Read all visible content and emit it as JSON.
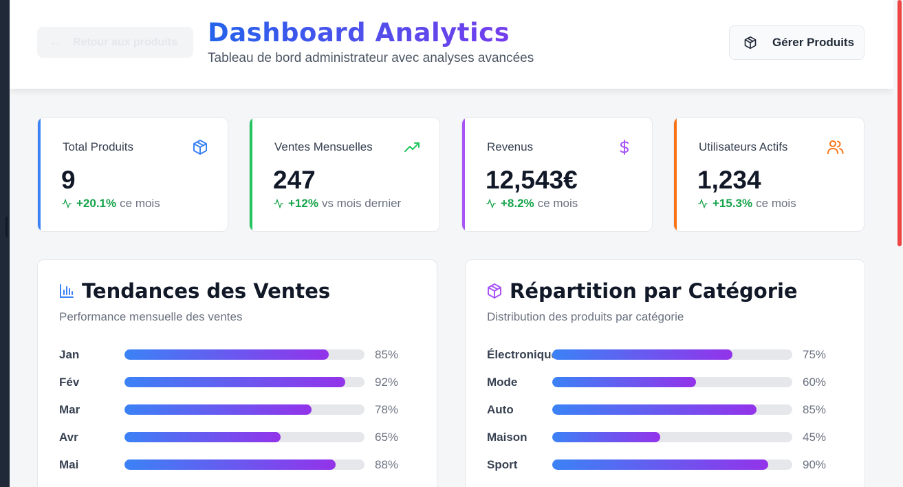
{
  "header": {
    "back_label": "Retour aux produits",
    "title": "Dashboard Analytics",
    "subtitle": "Tableau de bord administrateur avec analyses avancées",
    "manage_label": "Gérer Produits"
  },
  "stats": [
    {
      "label": "Total Produits",
      "value": "9",
      "delta": "+20.1%",
      "suffix": "ce mois",
      "icon": "package-icon",
      "color": "#3b82f6"
    },
    {
      "label": "Ventes Mensuelles",
      "value": "247",
      "delta": "+12%",
      "suffix": "vs mois dernier",
      "icon": "trending-up-icon",
      "color": "#22c55e"
    },
    {
      "label": "Revenus",
      "value": "12,543€",
      "delta": "+8.2%",
      "suffix": "ce mois",
      "icon": "dollar-icon",
      "color": "#a855f7"
    },
    {
      "label": "Utilisateurs Actifs",
      "value": "1,234",
      "delta": "+15.3%",
      "suffix": "ce mois",
      "icon": "users-icon",
      "color": "#f97316"
    }
  ],
  "sales": {
    "title": "Tendances des Ventes",
    "subtitle": "Performance mensuelle des ventes",
    "rows": [
      {
        "label": "Jan",
        "value": 85,
        "text": "85%"
      },
      {
        "label": "Fév",
        "value": 92,
        "text": "92%"
      },
      {
        "label": "Mar",
        "value": 78,
        "text": "78%"
      },
      {
        "label": "Avr",
        "value": 65,
        "text": "65%"
      },
      {
        "label": "Mai",
        "value": 88,
        "text": "88%"
      }
    ]
  },
  "categories": {
    "title": "Répartition par Catégorie",
    "subtitle": "Distribution des produits par catégorie",
    "rows": [
      {
        "label": "Électronique",
        "value": 75,
        "text": "75%"
      },
      {
        "label": "Mode",
        "value": 60,
        "text": "60%"
      },
      {
        "label": "Auto",
        "value": 85,
        "text": "85%"
      },
      {
        "label": "Maison",
        "value": 45,
        "text": "45%"
      },
      {
        "label": "Sport",
        "value": 90,
        "text": "90%"
      }
    ]
  },
  "colors": {
    "accent_blue": "#2563eb",
    "accent_purple": "#7c3aed",
    "positive": "#16a34a"
  }
}
